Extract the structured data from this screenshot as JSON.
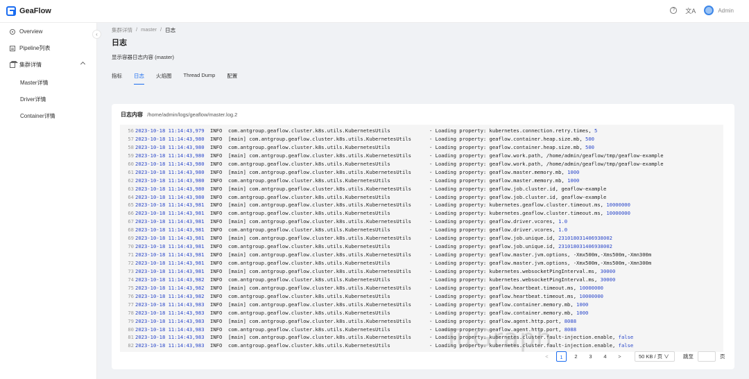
{
  "app": {
    "name": "GeaFlow",
    "user": "Admin",
    "help_icon": "question-circle-icon",
    "lang_icon": "translate-icon"
  },
  "sidebar": {
    "items": [
      {
        "label": "Overview",
        "icon": "overview-icon"
      },
      {
        "label": "Pipeline列表",
        "icon": "list-icon"
      },
      {
        "label": "集群详情",
        "icon": "home-icon",
        "expanded": true
      }
    ],
    "subitems": [
      "Master详情",
      "Driver详情",
      "Container详情"
    ]
  },
  "breadcrumb": [
    "集群详情",
    "master",
    "日志"
  ],
  "page": {
    "title": "日志",
    "description": "显示容器日志内容 (master)"
  },
  "tabs": [
    "指标",
    "日志",
    "火焰图",
    "Thread Dump",
    "配置"
  ],
  "active_tab": "日志",
  "log": {
    "label": "日志内容",
    "path": "/home/admin/logs/geaflow/master.log.2",
    "lines": [
      {
        "n": "56",
        "ts": "2023-10-18 11:14:43,979",
        "lvl": "INFO",
        "src": "com.antgroup.geaflow.cluster.k8s.utils.KubernetesUtils",
        "msg": "- Loading property: kubernetes.connection.retry.times, ",
        "val": "5"
      },
      {
        "n": "57",
        "ts": "2023-10-18 11:14:43,980",
        "lvl": "INFO",
        "src": "[main] com.antgroup.geaflow.cluster.k8s.utils.KubernetesUtils",
        "msg": "- Loading property: geaflow.container.heap.size.mb, ",
        "val": "500"
      },
      {
        "n": "58",
        "ts": "2023-10-18 11:14:43,980",
        "lvl": "INFO",
        "src": "com.antgroup.geaflow.cluster.k8s.utils.KubernetesUtils",
        "msg": "- Loading property: geaflow.container.heap.size.mb, ",
        "val": "500"
      },
      {
        "n": "59",
        "ts": "2023-10-18 11:14:43,980",
        "lvl": "INFO",
        "src": "[main] com.antgroup.geaflow.cluster.k8s.utils.KubernetesUtils",
        "msg": "- Loading property: geaflow.work.path, /home/admin/geaflow/tmp/geaflow-example",
        "val": ""
      },
      {
        "n": "60",
        "ts": "2023-10-18 11:14:43,980",
        "lvl": "INFO",
        "src": "com.antgroup.geaflow.cluster.k8s.utils.KubernetesUtils",
        "msg": "- Loading property: geaflow.work.path, /home/admin/geaflow/tmp/geaflow-example",
        "val": ""
      },
      {
        "n": "61",
        "ts": "2023-10-18 11:14:43,980",
        "lvl": "INFO",
        "src": "[main] com.antgroup.geaflow.cluster.k8s.utils.KubernetesUtils",
        "msg": "- Loading property: geaflow.master.memory.mb, ",
        "val": "1000"
      },
      {
        "n": "62",
        "ts": "2023-10-18 11:14:43,980",
        "lvl": "INFO",
        "src": "com.antgroup.geaflow.cluster.k8s.utils.KubernetesUtils",
        "msg": "- Loading property: geaflow.master.memory.mb, ",
        "val": "1000"
      },
      {
        "n": "63",
        "ts": "2023-10-18 11:14:43,980",
        "lvl": "INFO",
        "src": "[main] com.antgroup.geaflow.cluster.k8s.utils.KubernetesUtils",
        "msg": "- Loading property: geaflow.job.cluster.id, geaflow-example",
        "val": ""
      },
      {
        "n": "64",
        "ts": "2023-10-18 11:14:43,980",
        "lvl": "INFO",
        "src": "com.antgroup.geaflow.cluster.k8s.utils.KubernetesUtils",
        "msg": "- Loading property: geaflow.job.cluster.id, geaflow-example",
        "val": ""
      },
      {
        "n": "65",
        "ts": "2023-10-18 11:14:43,981",
        "lvl": "INFO",
        "src": "[main] com.antgroup.geaflow.cluster.k8s.utils.KubernetesUtils",
        "msg": "- Loading property: kubernetes.geaflow.cluster.timeout.ms, ",
        "val": "10000000"
      },
      {
        "n": "66",
        "ts": "2023-10-18 11:14:43,981",
        "lvl": "INFO",
        "src": "com.antgroup.geaflow.cluster.k8s.utils.KubernetesUtils",
        "msg": "- Loading property: kubernetes.geaflow.cluster.timeout.ms, ",
        "val": "10000000"
      },
      {
        "n": "67",
        "ts": "2023-10-18 11:14:43,981",
        "lvl": "INFO",
        "src": "[main] com.antgroup.geaflow.cluster.k8s.utils.KubernetesUtils",
        "msg": "- Loading property: geaflow.driver.vcores, ",
        "val": "1.0"
      },
      {
        "n": "68",
        "ts": "2023-10-18 11:14:43,981",
        "lvl": "INFO",
        "src": "com.antgroup.geaflow.cluster.k8s.utils.KubernetesUtils",
        "msg": "- Loading property: geaflow.driver.vcores, ",
        "val": "1.0"
      },
      {
        "n": "69",
        "ts": "2023-10-18 11:14:43,981",
        "lvl": "INFO",
        "src": "[main] com.antgroup.geaflow.cluster.k8s.utils.KubernetesUtils",
        "msg": "- Loading property: geaflow.job.unique.id, ",
        "val": "231018031406938002"
      },
      {
        "n": "70",
        "ts": "2023-10-18 11:14:43,981",
        "lvl": "INFO",
        "src": "com.antgroup.geaflow.cluster.k8s.utils.KubernetesUtils",
        "msg": "- Loading property: geaflow.job.unique.id, ",
        "val": "231018031406938002"
      },
      {
        "n": "71",
        "ts": "2023-10-18 11:14:43,981",
        "lvl": "INFO",
        "src": "[main] com.antgroup.geaflow.cluster.k8s.utils.KubernetesUtils",
        "msg": "- Loading property: geaflow.master.jvm.options, -Xmx500m,-Xms500m,-Xmn300m",
        "val": ""
      },
      {
        "n": "72",
        "ts": "2023-10-18 11:14:43,981",
        "lvl": "INFO",
        "src": "com.antgroup.geaflow.cluster.k8s.utils.KubernetesUtils",
        "msg": "- Loading property: geaflow.master.jvm.options, -Xmx500m,-Xms500m,-Xmn300m",
        "val": ""
      },
      {
        "n": "73",
        "ts": "2023-10-18 11:14:43,981",
        "lvl": "INFO",
        "src": "[main] com.antgroup.geaflow.cluster.k8s.utils.KubernetesUtils",
        "msg": "- Loading property: kubernetes.websocketPingInterval.ms, ",
        "val": "30000"
      },
      {
        "n": "74",
        "ts": "2023-10-18 11:14:43,982",
        "lvl": "INFO",
        "src": "com.antgroup.geaflow.cluster.k8s.utils.KubernetesUtils",
        "msg": "- Loading property: kubernetes.websocketPingInterval.ms, ",
        "val": "30000"
      },
      {
        "n": "75",
        "ts": "2023-10-18 11:14:43,982",
        "lvl": "INFO",
        "src": "[main] com.antgroup.geaflow.cluster.k8s.utils.KubernetesUtils",
        "msg": "- Loading property: geaflow.heartbeat.timeout.ms, ",
        "val": "10000000"
      },
      {
        "n": "76",
        "ts": "2023-10-18 11:14:43,982",
        "lvl": "INFO",
        "src": "com.antgroup.geaflow.cluster.k8s.utils.KubernetesUtils",
        "msg": "- Loading property: geaflow.heartbeat.timeout.ms, ",
        "val": "10000000"
      },
      {
        "n": "77",
        "ts": "2023-10-18 11:14:43,983",
        "lvl": "INFO",
        "src": "[main] com.antgroup.geaflow.cluster.k8s.utils.KubernetesUtils",
        "msg": "- Loading property: geaflow.container.memory.mb, ",
        "val": "1000"
      },
      {
        "n": "78",
        "ts": "2023-10-18 11:14:43,983",
        "lvl": "INFO",
        "src": "com.antgroup.geaflow.cluster.k8s.utils.KubernetesUtils",
        "msg": "- Loading property: geaflow.container.memory.mb, ",
        "val": "1000"
      },
      {
        "n": "79",
        "ts": "2023-10-18 11:14:43,983",
        "lvl": "INFO",
        "src": "[main] com.antgroup.geaflow.cluster.k8s.utils.KubernetesUtils",
        "msg": "- Loading property: geaflow.agent.http.port, ",
        "val": "8088"
      },
      {
        "n": "80",
        "ts": "2023-10-18 11:14:43,983",
        "lvl": "INFO",
        "src": "com.antgroup.geaflow.cluster.k8s.utils.KubernetesUtils",
        "msg": "- Loading property: geaflow.agent.http.port, ",
        "val": "8088"
      },
      {
        "n": "81",
        "ts": "2023-10-18 11:14:43,983",
        "lvl": "INFO",
        "src": "[main] com.antgroup.geaflow.cluster.k8s.utils.KubernetesUtils",
        "msg": "- Loading property: kubernetes.cluster.fault-injection.enable, ",
        "val": "false"
      },
      {
        "n": "82",
        "ts": "2023-10-18 11:14:43,983",
        "lvl": "INFO",
        "src": "com.antgroup.geaflow.cluster.k8s.utils.KubernetesUtils",
        "msg": "- Loading property: kubernetes.cluster.fault-injection.enable, ",
        "val": "false"
      }
    ]
  },
  "pagination": {
    "prev": "<",
    "pages": [
      "1",
      "2",
      "3",
      "4"
    ],
    "current": "1",
    "next": ">",
    "page_size": "50 KB / 页 ∨",
    "jump_label": "跳至",
    "jump_suffix": "页"
  },
  "watermark": "TuGraph"
}
